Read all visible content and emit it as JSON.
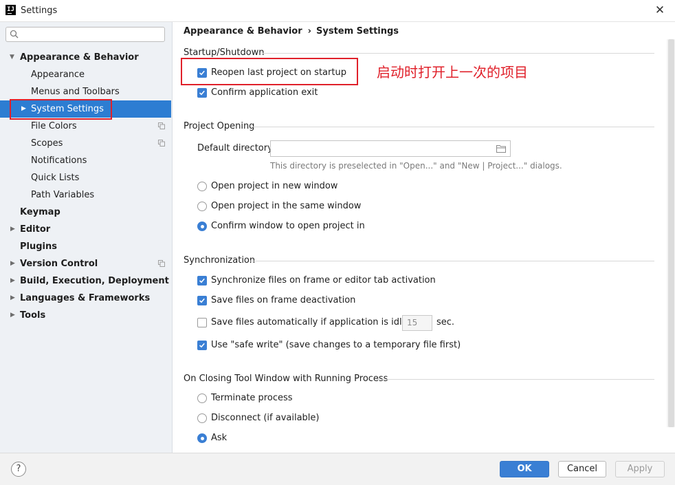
{
  "window": {
    "title": "Settings",
    "app_icon": "IJ"
  },
  "sidebar": {
    "search": {
      "value": "",
      "placeholder": ""
    },
    "items": [
      {
        "label": "Appearance & Behavior",
        "expanded": true
      },
      {
        "label": "Appearance"
      },
      {
        "label": "Menus and Toolbars"
      },
      {
        "label": "System Settings",
        "selected": true
      },
      {
        "label": "File Colors"
      },
      {
        "label": "Scopes"
      },
      {
        "label": "Notifications"
      },
      {
        "label": "Quick Lists"
      },
      {
        "label": "Path Variables"
      },
      {
        "label": "Keymap"
      },
      {
        "label": "Editor"
      },
      {
        "label": "Plugins"
      },
      {
        "label": "Version Control"
      },
      {
        "label": "Build, Execution, Deployment"
      },
      {
        "label": "Languages & Frameworks"
      },
      {
        "label": "Tools"
      }
    ]
  },
  "breadcrumb": {
    "parent": "Appearance & Behavior",
    "separator": "›",
    "current": "System Settings"
  },
  "startup": {
    "title": "Startup/Shutdown",
    "reopen_label": "Reopen last project on startup",
    "reopen_checked": true,
    "confirm_exit_label": "Confirm application exit",
    "confirm_exit_checked": true
  },
  "annotation": "启动时打开上一次的项目",
  "project_opening": {
    "title": "Project Opening",
    "default_dir_label": "Default directory:",
    "default_dir_value": "",
    "hint": "This directory is preselected in \"Open...\" and \"New | Project...\" dialogs.",
    "options": [
      "Open project in new window",
      "Open project in the same window",
      "Confirm window to open project in"
    ],
    "selected": 2
  },
  "sync": {
    "title": "Synchronization",
    "sync_files_label": "Synchronize files on frame or editor tab activation",
    "save_deactivation_label": "Save files on frame deactivation",
    "save_idle_label": "Save files automatically if application is idle for",
    "idle_value": "15",
    "idle_unit": "sec.",
    "safe_write_label": "Use \"safe write\" (save changes to a temporary file first)",
    "states": {
      "sync_files": true,
      "save_deactivation": true,
      "save_idle": false,
      "safe_write": true
    }
  },
  "closing": {
    "title": "On Closing Tool Window with Running Process",
    "options": [
      "Terminate process",
      "Disconnect (if available)",
      "Ask"
    ],
    "selected": 2
  },
  "footer": {
    "help": "?",
    "ok": "OK",
    "cancel": "Cancel",
    "apply": "Apply"
  },
  "colors": {
    "accent": "#3a7fd4",
    "selection": "#2d7dd2",
    "annotation": "#e0202a"
  }
}
